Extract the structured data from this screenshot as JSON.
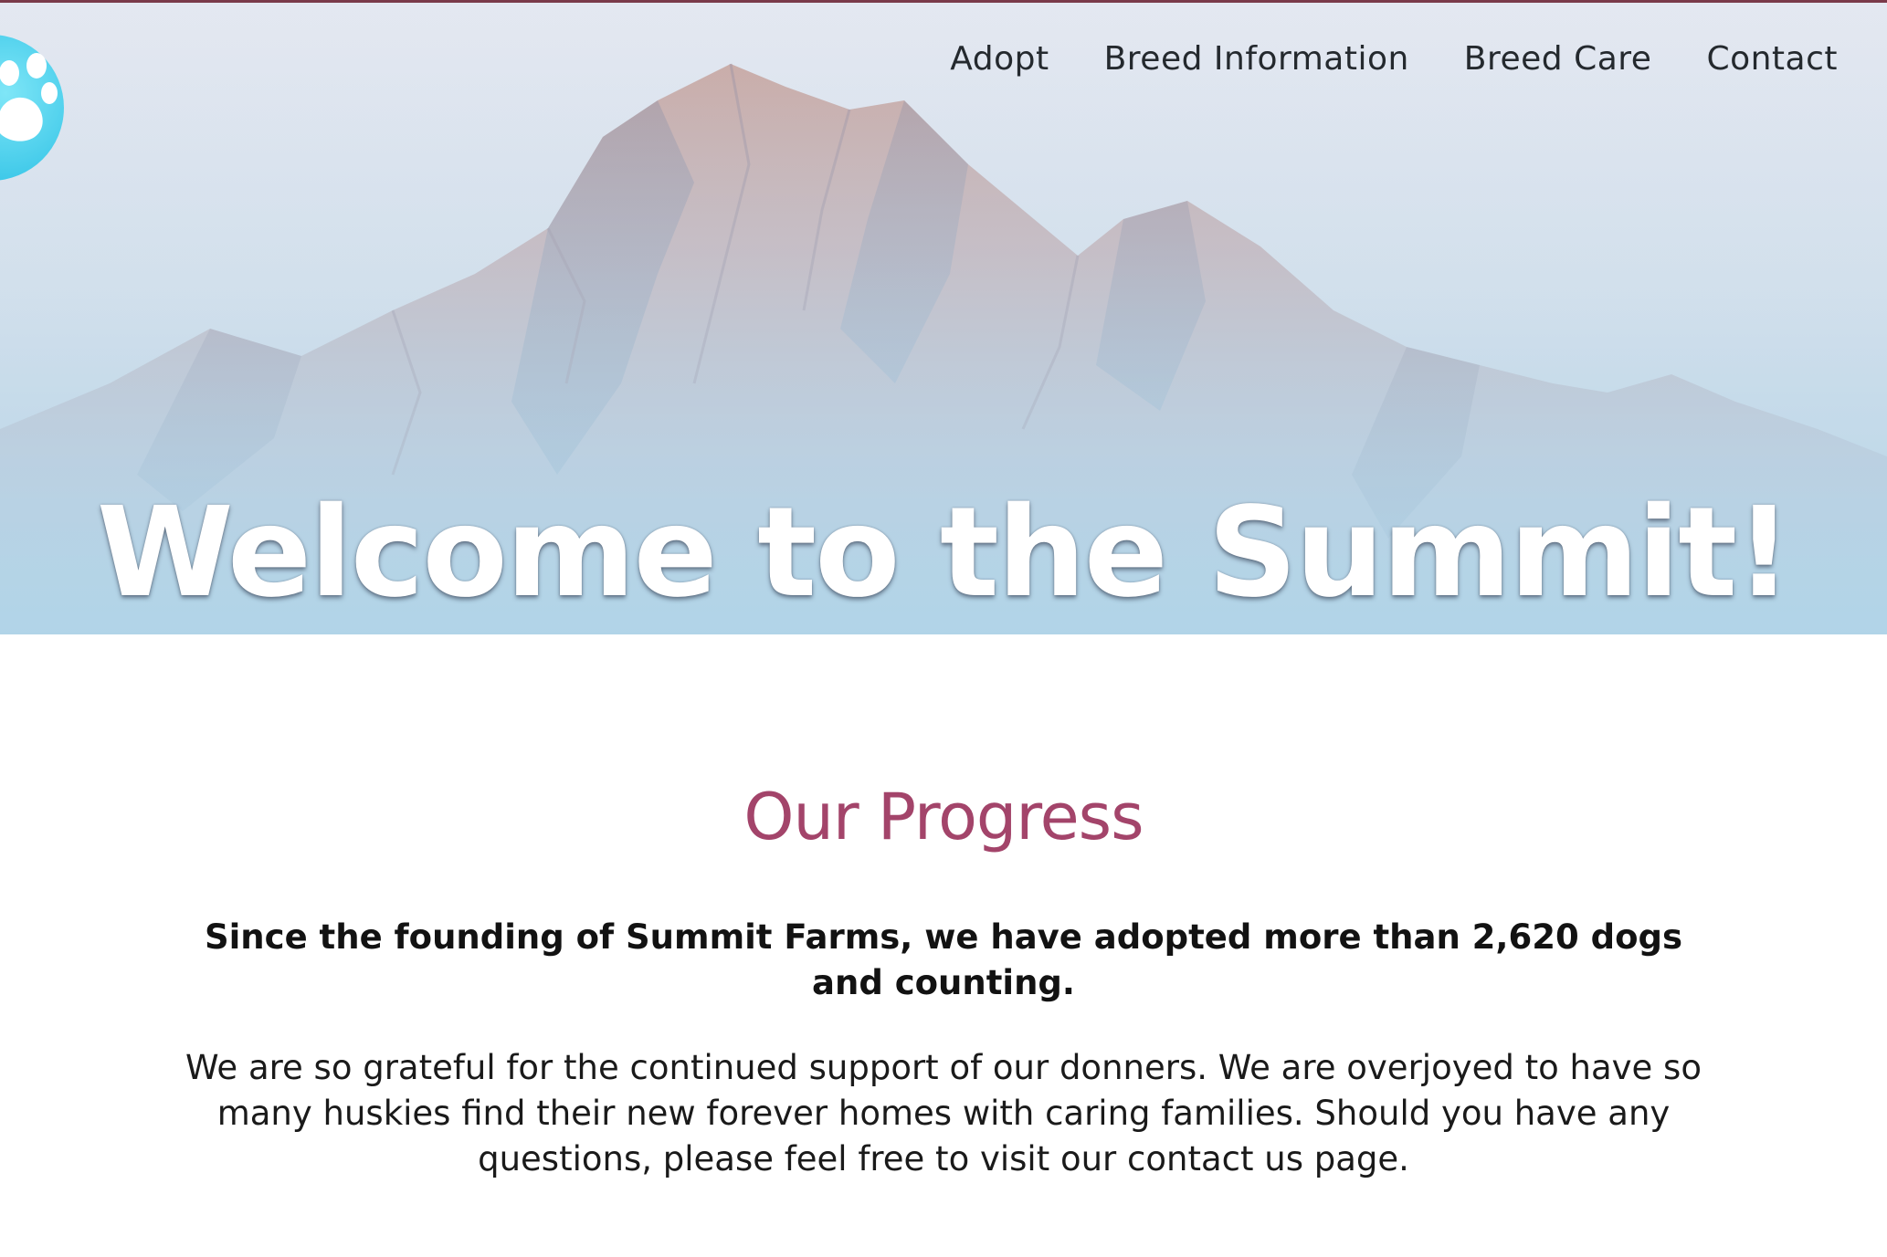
{
  "colors": {
    "accent_heading": "#a3446a",
    "logo": "#3fc9e9",
    "nav_text": "#24292e",
    "top_rule": "#7a3a4a"
  },
  "logo": {
    "icon": "paw-icon"
  },
  "nav": {
    "items": [
      {
        "label": "Adopt"
      },
      {
        "label": "Breed Information"
      },
      {
        "label": "Breed Care"
      },
      {
        "label": "Contact"
      }
    ]
  },
  "hero": {
    "title": "Welcome to the Summit!",
    "background": "mountain-peak-image"
  },
  "progress": {
    "title": "Our Progress",
    "lead": "Since the founding of Summit Farms, we have adopted more than 2,620 dogs and counting.",
    "body": "We are so grateful for the continued support of our donners. We are overjoyed to have so many huskies find their new forever homes with caring families. Should you have any questions, please feel free to visit our contact us page."
  }
}
